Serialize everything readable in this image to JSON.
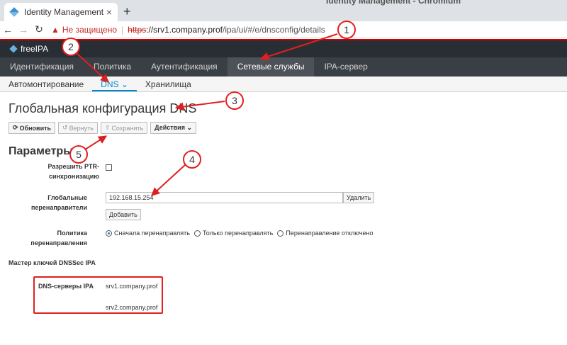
{
  "browser": {
    "window_title": "Identity Management - Chromium",
    "tab_title": "Identity Management",
    "tab_close": "×",
    "new_tab": "+",
    "security_warning": "Не защищено",
    "url_scheme": "https",
    "url_host": "://srv1.company.prof",
    "url_path": "/ipa/ui/#/e/dnsconfig/details"
  },
  "brand": {
    "name": "freeIPA"
  },
  "mainnav": {
    "items": [
      {
        "label": "Идентификация"
      },
      {
        "label": "Политика"
      },
      {
        "label": "Аутентификация"
      },
      {
        "label": "Сетевые службы"
      },
      {
        "label": "IPA-сервер"
      }
    ]
  },
  "subnav": {
    "items": [
      {
        "label": "Автомонтирование"
      },
      {
        "label": "DNS ⌄"
      },
      {
        "label": "Хранилища"
      }
    ]
  },
  "page": {
    "title": "Глобальная конфигурация DNS",
    "buttons": {
      "refresh": "Обновить",
      "revert": "Вернуть",
      "save": "Сохранить",
      "actions": "Действия ⌄"
    },
    "section_title": "Параметры",
    "ptr_label": "Разрешить PTR-синхронизацию",
    "forwarders_label": "Глобальные перенаправители",
    "forwarder_value": "192.168.15.254",
    "delete_label": "Удалить",
    "add_label": "Добавить",
    "policy_label": "Политика перенаправления",
    "policy_options": [
      {
        "label": "Сначала перенаправлять"
      },
      {
        "label": "Только перенаправлять"
      },
      {
        "label": "Перенаправление отключено"
      }
    ],
    "dnssec_label": "Мастер ключей DNSSec IPA",
    "dns_servers_label": "DNS-серверы IPA",
    "dns_servers": [
      "srv1.company.prof",
      "srv2.company.prof"
    ]
  },
  "annotations": [
    "1",
    "2",
    "3",
    "4",
    "5"
  ]
}
